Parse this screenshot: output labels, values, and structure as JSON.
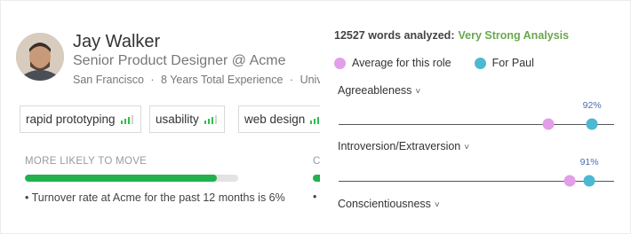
{
  "profile": {
    "name": "Jay Walker",
    "role": "Senior Product Designer @ Acme",
    "location": "San Francisco",
    "sep1": "·",
    "experience": "8 Years Total Experience",
    "sep2": "·",
    "extra": "Univers",
    "skills": [
      {
        "label": "rapid prototyping",
        "level": 3
      },
      {
        "label": "usability",
        "level": 3
      },
      {
        "label": "web design",
        "level": 3
      }
    ],
    "move_label": "MORE LIKELY TO MOVE",
    "move_label_cut": "C",
    "move_progress": 0.9,
    "turnover_text": "Turnover rate at Acme for the past 12 months is 6%",
    "bullet": "•"
  },
  "analysis": {
    "words_prefix": "12527 words analyzed:",
    "strength": "Very Strong Analysis",
    "legend": [
      {
        "label": "Average for this role",
        "color": "#e29ee8"
      },
      {
        "label": "For Paul",
        "color": "#4db8d1"
      }
    ],
    "chevron": "˅",
    "traits": [
      {
        "name": "Agreeableness",
        "average": 0.76,
        "paul": 0.92,
        "paul_label": "92%"
      },
      {
        "name": "Introversion/Extraversion",
        "average": 0.84,
        "paul": 0.91,
        "paul_label": "91%"
      },
      {
        "name": "Conscientiousness"
      }
    ]
  }
}
